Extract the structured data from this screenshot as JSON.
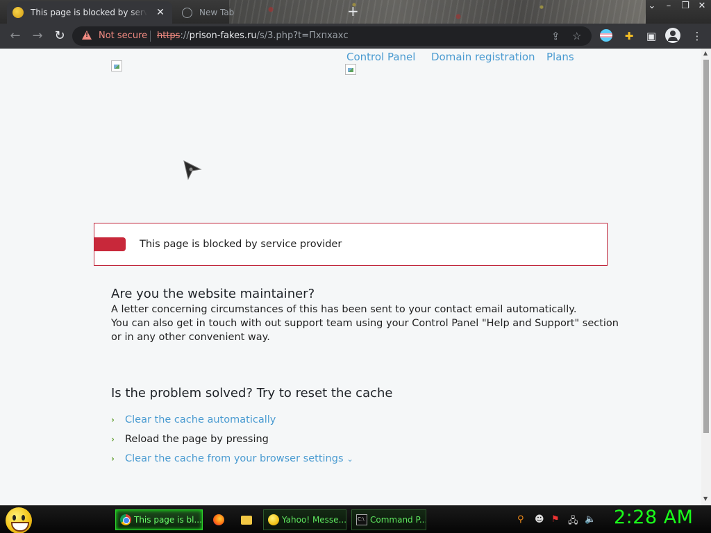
{
  "browser": {
    "tabs": [
      {
        "title": "This page is blocked by service p",
        "active": true
      },
      {
        "title": "New Tab",
        "active": false
      }
    ],
    "security_label": "Not secure",
    "url_scheme": "https",
    "url_host": "prison-fakes.ru",
    "url_path": "/s/3.php?t=Пхпхахс"
  },
  "page": {
    "nav": [
      "Control Panel",
      "Domain registration",
      "Plans"
    ],
    "alert": "This page is blocked by service provider",
    "maintainer_heading": "Are you the website maintainer?",
    "maintainer_text": [
      "A letter concerning circumstances of this has been sent to your contact email automatically.",
      "You can also get in touch with out support team using your Control Panel \"Help and Support\" section",
      "or in any other convenient way."
    ],
    "cache_heading": "Is the problem solved? Try to reset the cache",
    "cache_items": [
      {
        "text": "Clear the cache automatically",
        "link": true
      },
      {
        "text": "Reload the page by pressing",
        "link": false
      },
      {
        "text": "Clear the cache from your browser settings",
        "link": true
      }
    ],
    "link_color": "#4a9bd1",
    "alert_color": "#c8283a"
  },
  "taskbar": {
    "buttons": [
      {
        "label": "This page is bl...",
        "icon": "chrome-icon",
        "active": true
      },
      {
        "label": "Yahoo! Messe...",
        "icon": "yahoo-icon",
        "active": false
      },
      {
        "label": "Command P...",
        "icon": "cmd-icon",
        "active": false
      }
    ],
    "clock": "2:28 AM",
    "clock_color": "#1aff1a"
  }
}
